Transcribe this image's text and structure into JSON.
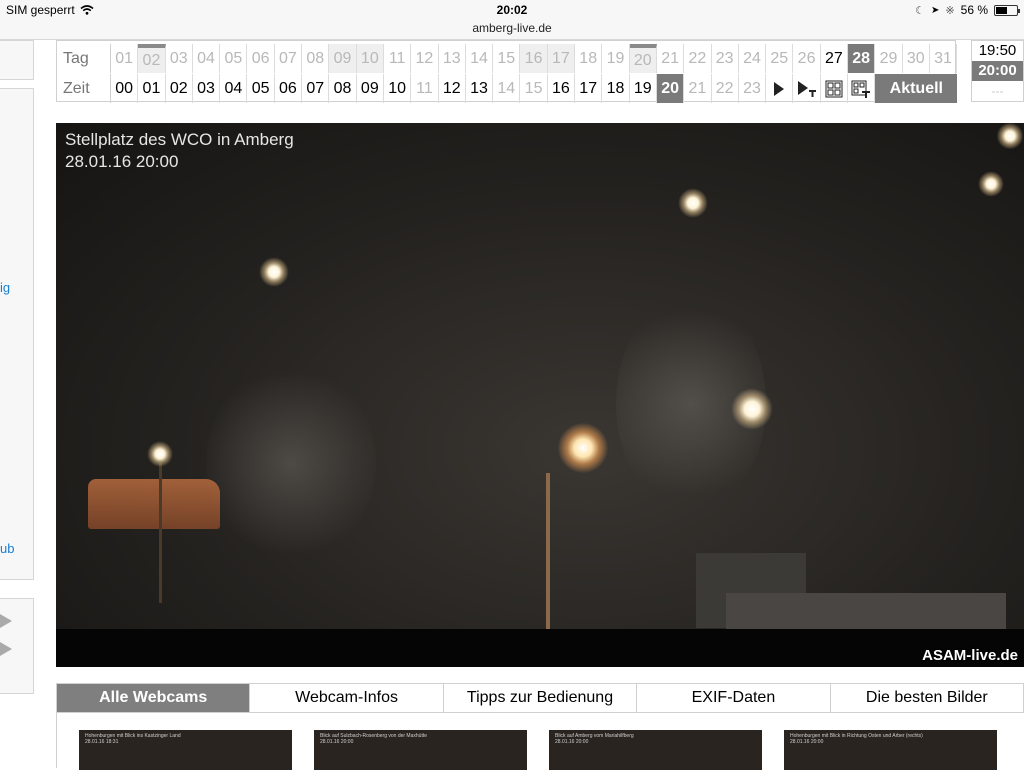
{
  "status_bar": {
    "carrier": "SIM gesperrt",
    "time": "20:02",
    "url": "amberg-live.de",
    "battery": "56 %",
    "battery_level": 0.56
  },
  "sidebar": {
    "link_1": "ig",
    "link_2": "ub"
  },
  "selector": {
    "tag_label": "Tag",
    "zeit_label": "Zeit",
    "days": [
      "01",
      "02",
      "03",
      "04",
      "05",
      "06",
      "07",
      "08",
      "09",
      "10",
      "11",
      "12",
      "13",
      "14",
      "15",
      "16",
      "17",
      "18",
      "19",
      "20",
      "21",
      "22",
      "23",
      "24",
      "25",
      "26",
      "27",
      "28",
      "29",
      "30",
      "31"
    ],
    "hours": [
      "00",
      "01",
      "02",
      "03",
      "04",
      "05",
      "06",
      "07",
      "08",
      "09",
      "10",
      "11",
      "12",
      "13",
      "14",
      "15",
      "16",
      "17",
      "18",
      "19",
      "20",
      "21",
      "22",
      "23"
    ],
    "selected_day": "28",
    "selected_hour": "20",
    "aktuell_label": "Aktuell"
  },
  "time_box": {
    "prev": "19:50",
    "current": "20:00",
    "next": "---"
  },
  "webcam": {
    "title": "Stellplatz des WCO in Amberg",
    "datetime": "28.01.16 20:00",
    "logo": "ASAM-live.de"
  },
  "tabs": [
    "Alle Webcams",
    "Webcam-Infos",
    "Tipps zur Bedienung",
    "EXIF-Daten",
    "Die besten Bilder"
  ],
  "thumbnails": [
    {
      "caption": "Hohenburgen mit Blick ins Kastzinger Land",
      "meta": "28.01.16 18:31"
    },
    {
      "caption": "Blick auf Sulzbach-Rosenberg von der Maxhütte",
      "meta": "28.01.16 20:00"
    },
    {
      "caption": "Blick auf Amberg vom Mariahilfberg",
      "meta": "28.01.16 20:00"
    },
    {
      "caption": "Hohenburgen mit Blick in Richtung Osten und Arber (rechts)",
      "meta": "28.01.16 20:00"
    }
  ]
}
